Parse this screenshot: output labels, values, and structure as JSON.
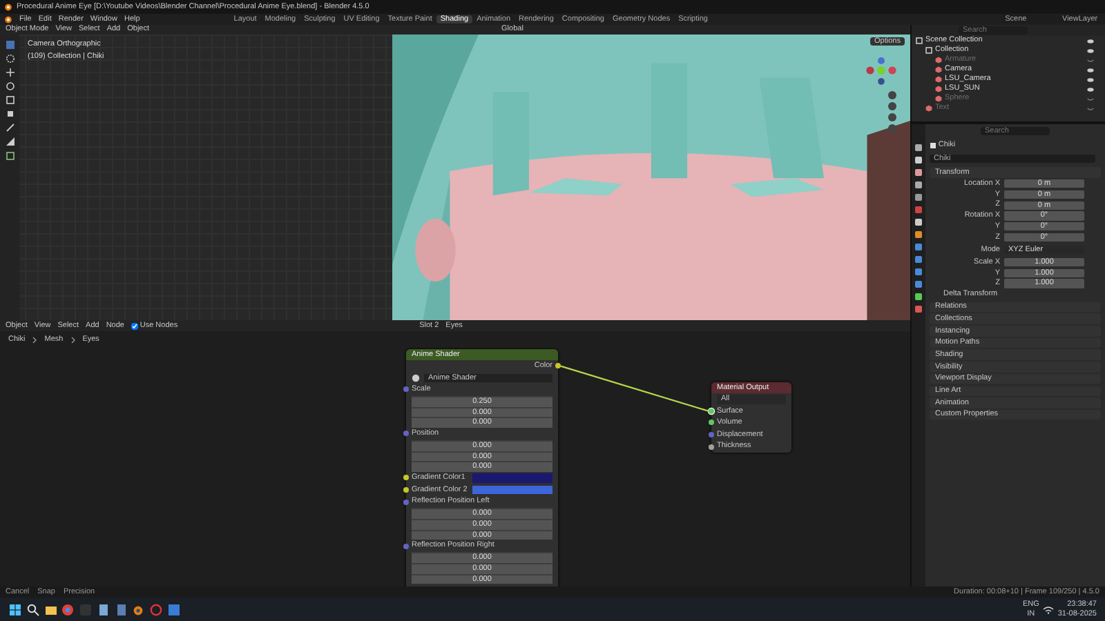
{
  "window": {
    "title": "Procedural Anime Eye [D:\\Youtube Videos\\Blender Channel\\Procedural Anime Eye.blend] - Blender 4.5.0"
  },
  "menu": [
    "File",
    "Edit",
    "Render",
    "Window",
    "Help"
  ],
  "workspaces": [
    {
      "label": "Layout",
      "selected": false
    },
    {
      "label": "Modeling",
      "selected": false
    },
    {
      "label": "Sculpting",
      "selected": false
    },
    {
      "label": "UV Editing",
      "selected": false
    },
    {
      "label": "Texture Paint",
      "selected": false
    },
    {
      "label": "Shading",
      "selected": true
    },
    {
      "label": "Animation",
      "selected": false
    },
    {
      "label": "Rendering",
      "selected": false
    },
    {
      "label": "Compositing",
      "selected": false
    },
    {
      "label": "Geometry Nodes",
      "selected": false
    },
    {
      "label": "Scripting",
      "selected": false
    }
  ],
  "scene": "Scene",
  "view_layer": "ViewLayer",
  "viewport": {
    "mode": "Object Mode",
    "menus": [
      "View",
      "Select",
      "Add",
      "Object"
    ],
    "orientation": "Global",
    "options": "Options",
    "camera_label": "Camera Orthographic",
    "collection_label": "(109) Collection | Chiki"
  },
  "outliner": {
    "search": {
      "placeholder": "Search"
    },
    "tree": [
      {
        "label": "Scene Collection",
        "visible": true,
        "children": [
          {
            "label": "Collection",
            "visible": true,
            "children": [
              {
                "label": "Armature",
                "visible": false
              },
              {
                "label": "Camera",
                "visible": true
              },
              {
                "label": "LSU_Camera",
                "visible": true
              },
              {
                "label": "LSU_SUN",
                "visible": true
              },
              {
                "label": "Sphere",
                "visible": false
              }
            ]
          },
          {
            "label": "Text",
            "visible": false
          }
        ]
      }
    ]
  },
  "properties": {
    "search": {
      "placeholder": "Search"
    },
    "context": "Chiki",
    "object_name": "Chiki",
    "transform": {
      "title": "Transform",
      "rows": [
        {
          "label": "Location X",
          "value": "0 m",
          "kind": "field"
        },
        {
          "label": "Y",
          "value": "0 m",
          "kind": "field"
        },
        {
          "label": "Z",
          "value": "0 m",
          "kind": "field"
        },
        {
          "label": "Rotation X",
          "value": "0°",
          "kind": "field"
        },
        {
          "label": "Y",
          "value": "0°",
          "kind": "field"
        },
        {
          "label": "Z",
          "value": "0°",
          "kind": "field"
        },
        {
          "label": "Mode",
          "value": "XYZ Euler",
          "kind": "dropdown"
        },
        {
          "label": "Scale X",
          "value": "1.000",
          "kind": "field"
        },
        {
          "label": "Y",
          "value": "1.000",
          "kind": "field"
        },
        {
          "label": "Z",
          "value": "1.000",
          "kind": "field"
        }
      ],
      "delta": "Delta Transform"
    },
    "panels": [
      "Relations",
      "Collections",
      "Instancing",
      "Motion Paths",
      "Shading",
      "Visibility",
      "Viewport Display",
      "Line Art",
      "Animation",
      "Custom Properties"
    ]
  },
  "node_editor": {
    "type": "Object",
    "menus": [
      "View",
      "Select",
      "Add",
      "Node"
    ],
    "use_nodes": {
      "label": "Use Nodes",
      "checked": true
    },
    "slot": "Slot 2",
    "material": "Eyes",
    "breadcrumbs": [
      "Chiki",
      "Mesh",
      "Eyes"
    ],
    "shader_node": {
      "title": "Anime Shader",
      "output": "Color",
      "group": "Anime Shader",
      "inputs": [
        {
          "kind": "vector",
          "label": "Scale",
          "values": [
            "0.250",
            "0.000",
            "0.000"
          ]
        },
        {
          "kind": "vector",
          "label": "Position",
          "values": [
            "0.000",
            "0.000",
            "0.000"
          ]
        },
        {
          "kind": "color",
          "label": "Gradient Color1",
          "color": "#1b1870"
        },
        {
          "kind": "color",
          "label": "Gradient Color 2",
          "color": "#3c66d9"
        },
        {
          "kind": "vector",
          "label": "Reflection Position Left",
          "values": [
            "0.000",
            "0.000",
            "0.000"
          ]
        },
        {
          "kind": "vector",
          "label": "Reflection Position Right",
          "values": [
            "0.000",
            "0.000",
            "0.000"
          ]
        }
      ]
    },
    "output_node": {
      "title": "Material Output",
      "target": "All",
      "inputs": [
        {
          "label": "Surface",
          "kind": "shader",
          "linked": true
        },
        {
          "label": "Volume",
          "kind": "shader",
          "linked": false
        },
        {
          "label": "Displacement",
          "kind": "vector",
          "linked": false
        },
        {
          "label": "Thickness",
          "kind": "float",
          "linked": false
        }
      ]
    }
  },
  "status_bar": {
    "hints": [
      "Cancel",
      "Snap",
      "Precision"
    ],
    "info": "Duration: 00:08+10 | Frame 109/250 | 4.5.0"
  },
  "taskbar": {
    "language": "ENG",
    "region": "IN",
    "time": "23:38:47",
    "date": "31-08-2025"
  }
}
